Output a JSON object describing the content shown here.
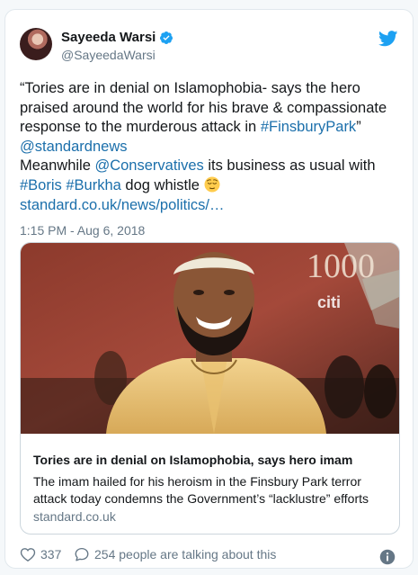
{
  "tweet": {
    "author_name": "Sayeeda Warsi",
    "handle": "@SayeedaWarsi",
    "text_parts": {
      "p1": "“Tories are in denial on Islamophobia- says the hero praised around the world for his brave & compassionate response to the murderous attack in ",
      "p1_link": "#FinsburyPark",
      "p1_end": "”",
      "p2_link": "@standardnews",
      "p3": "Meanwhile ",
      "p3_link": "@Conservatives",
      "p3_end": " its business as usual with",
      "p4_link1": "#Boris",
      "p4_link2": "#Burkha",
      "p4_end": " dog whistle ",
      "p5_link": "standard.co.uk/news/politics/…"
    },
    "timestamp": "1:15 PM - Aug 6, 2018",
    "emoji": "relieved-face-icon"
  },
  "link_card": {
    "image_text": {
      "big_number": "1000",
      "small_text": "citi"
    },
    "title": "Tories are in denial on Islamophobia, says hero imam",
    "description": "The imam hailed for his heroism in the Finsbury Park terror attack today condemns the Government’s “lacklustre” efforts",
    "domain": "standard.co.uk"
  },
  "footer": {
    "likes": "337",
    "talking": "254 people are talking about this"
  },
  "colors": {
    "link": "#1b6fab",
    "verified": "#1da1f2",
    "muted": "#657786"
  }
}
